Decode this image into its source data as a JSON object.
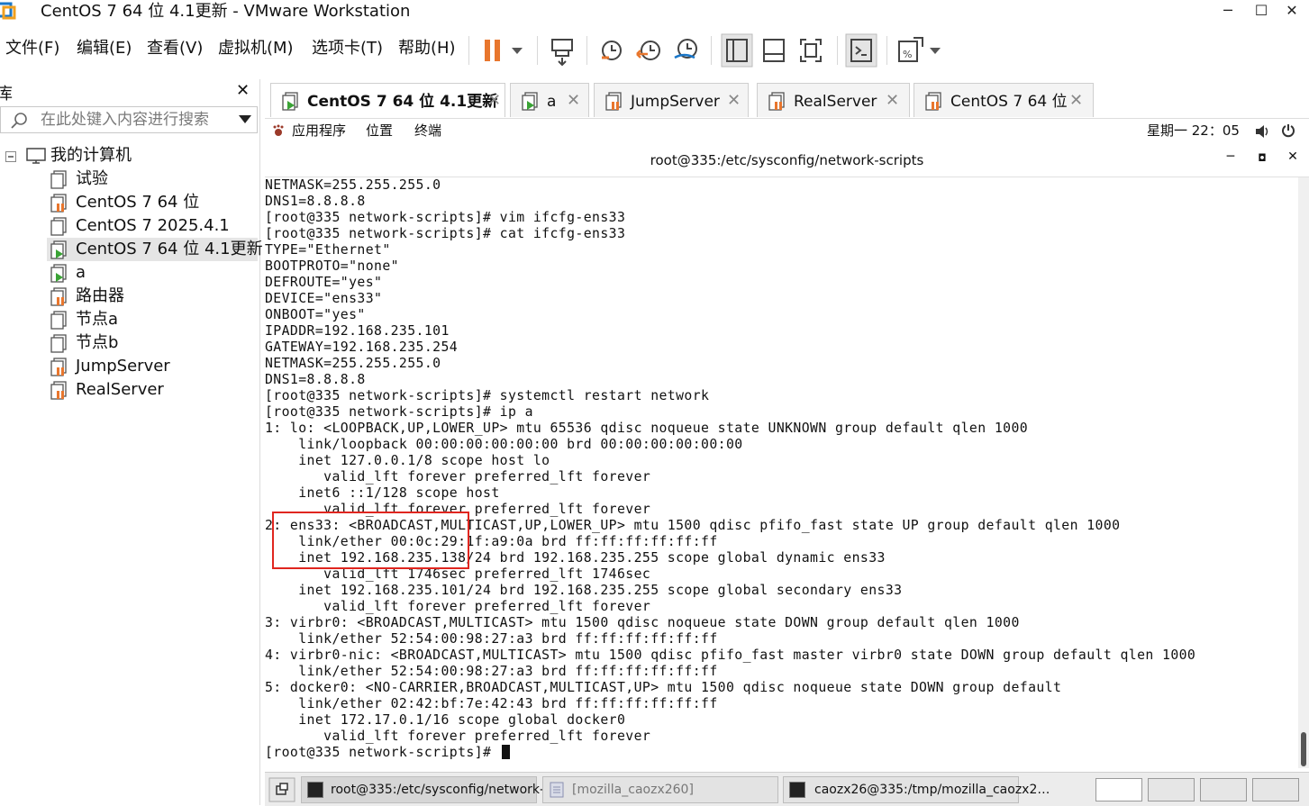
{
  "window": {
    "title": "CentOS 7 64 位 4.1更新 - VMware Workstation",
    "minimize": "─",
    "maximize": "☐",
    "close": "✕"
  },
  "menu": [
    "文件(F)",
    "编辑(E)",
    "查看(V)",
    "虚拟机(M)",
    "选项卡(T)",
    "帮助(H)"
  ],
  "library": {
    "title": "库",
    "close": "✕",
    "search_placeholder": "在此处键入内容进行搜索",
    "root": "我的计算机",
    "items": [
      {
        "label": "试验",
        "icon": "vm-icon"
      },
      {
        "label": "CentOS 7 64 位",
        "icon": "vm-suspended-icon"
      },
      {
        "label": "CentOS 7 2025.4.1",
        "icon": "vm-icon"
      },
      {
        "label": "CentOS 7 64 位 4.1更新",
        "icon": "vm-running-icon",
        "selected": true
      },
      {
        "label": "a",
        "icon": "vm-running-icon"
      },
      {
        "label": "路由器",
        "icon": "vm-suspended-icon"
      },
      {
        "label": "节点a",
        "icon": "vm-icon"
      },
      {
        "label": "节点b",
        "icon": "vm-icon"
      },
      {
        "label": "JumpServer",
        "icon": "vm-suspended-icon"
      },
      {
        "label": "RealServer",
        "icon": "vm-suspended-icon"
      }
    ]
  },
  "tabs": [
    {
      "label": "CentOS 7 64 位 4.1更新",
      "active": true,
      "icon": "vm-running-icon"
    },
    {
      "label": "a",
      "active": false,
      "icon": "vm-running-icon"
    },
    {
      "label": "JumpServer",
      "active": false,
      "icon": "vm-suspended-icon"
    },
    {
      "label": "RealServer",
      "active": false,
      "icon": "vm-suspended-icon"
    },
    {
      "label": "CentOS 7 64 位",
      "active": false,
      "icon": "vm-suspended-icon"
    }
  ],
  "guest_bar": {
    "applications": "应用程序",
    "places": "位置",
    "terminal": "终端",
    "clock": "星期一 22：05"
  },
  "terminal": {
    "title": "root@335:/etc/sysconfig/network-scripts",
    "lines": [
      "NETMASK=255.255.255.0",
      "DNS1=8.8.8.8",
      "[root@335 network-scripts]# vim ifcfg-ens33",
      "[root@335 network-scripts]# cat ifcfg-ens33",
      "TYPE=\"Ethernet\"",
      "BOOTPROTO=\"none\"",
      "DEFROUTE=\"yes\"",
      "DEVICE=\"ens33\"",
      "ONBOOT=\"yes\"",
      "IPADDR=192.168.235.101",
      "GATEWAY=192.168.235.254",
      "NETMASK=255.255.255.0",
      "DNS1=8.8.8.8",
      "[root@335 network-scripts]# systemctl restart network",
      "[root@335 network-scripts]# ip a",
      "1: lo: <LOOPBACK,UP,LOWER_UP> mtu 65536 qdisc noqueue state UNKNOWN group default qlen 1000",
      "    link/loopback 00:00:00:00:00:00 brd 00:00:00:00:00:00",
      "    inet 127.0.0.1/8 scope host lo",
      "       valid_lft forever preferred_lft forever",
      "    inet6 ::1/128 scope host",
      "       valid_lft forever preferred_lft forever",
      "2: ens33: <BROADCAST,MULTICAST,UP,LOWER_UP> mtu 1500 qdisc pfifo_fast state UP group default qlen 1000",
      "    link/ether 00:0c:29:1f:a9:0a brd ff:ff:ff:ff:ff:ff",
      "    inet 192.168.235.138/24 brd 192.168.235.255 scope global dynamic ens33",
      "       valid_lft 1746sec preferred_lft 1746sec",
      "    inet 192.168.235.101/24 brd 192.168.235.255 scope global secondary ens33",
      "       valid_lft forever preferred_lft forever",
      "3: virbr0: <BROADCAST,MULTICAST> mtu 1500 qdisc noqueue state DOWN group default qlen 1000",
      "    link/ether 52:54:00:98:27:a3 brd ff:ff:ff:ff:ff:ff",
      "4: virbr0-nic: <BROADCAST,MULTICAST> mtu 1500 qdisc pfifo_fast master virbr0 state DOWN group default qlen 1000",
      "    link/ether 52:54:00:98:27:a3 brd ff:ff:ff:ff:ff:ff",
      "5: docker0: <NO-CARRIER,BROADCAST,MULTICAST,UP> mtu 1500 qdisc noqueue state DOWN group default",
      "    link/ether 02:42:bf:7e:42:43 brd ff:ff:ff:ff:ff:ff",
      "    inet 172.17.0.1/16 scope global docker0",
      "       valid_lft forever preferred_lft forever"
    ],
    "prompt": "[root@335 network-scripts]# "
  },
  "taskbar": [
    {
      "label": "root@335:/etc/sysconfig/network-…",
      "icon": "terminal-icon",
      "active": true
    },
    {
      "label": "[mozilla_caozx260]",
      "icon": "file-manager-icon",
      "active": false
    },
    {
      "label": "caozx26@335:/tmp/mozilla_caozx2…",
      "icon": "terminal-icon",
      "active": false
    }
  ],
  "colors": {
    "accent_orange": "#e8762d",
    "vm_green": "#3aa335",
    "highlight_red": "#e0261f"
  }
}
